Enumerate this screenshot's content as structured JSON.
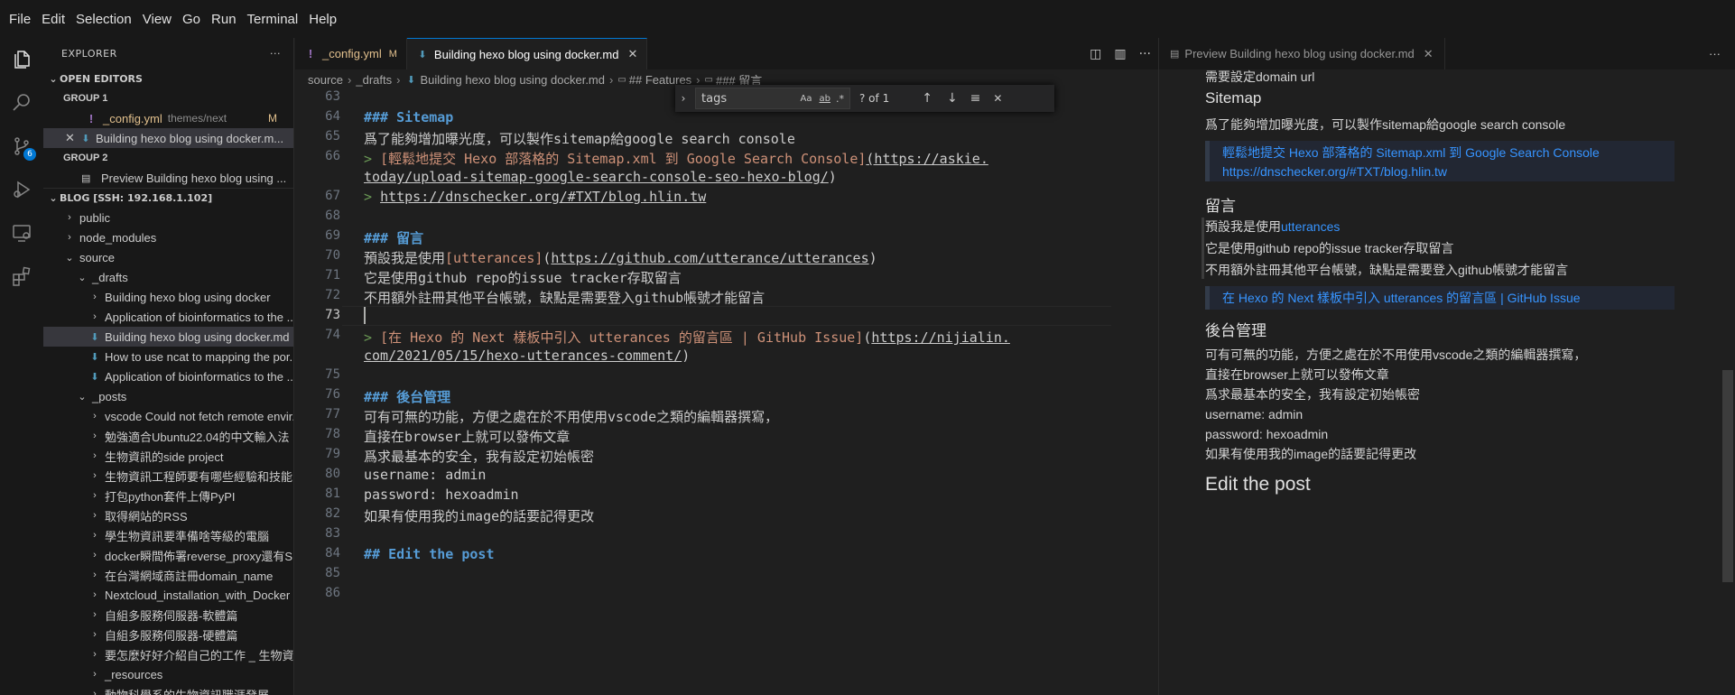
{
  "menu": [
    "File",
    "Edit",
    "Selection",
    "View",
    "Go",
    "Run",
    "Terminal",
    "Help"
  ],
  "explorer": {
    "title": "EXPLORER",
    "open_editors": "OPEN EDITORS",
    "group1": "GROUP 1",
    "g1_item1": "_config.yml",
    "g1_item1_path": "themes/next",
    "g1_item1_mod": "M",
    "g1_item2": "Building hexo blog using docker.m...",
    "group2": "GROUP 2",
    "g2_item1": "Preview Building hexo blog using ...",
    "workspace": "BLOG [SSH: 192.168.1.102]",
    "tree": [
      {
        "label": "public",
        "indent": 0,
        "type": "folder-closed"
      },
      {
        "label": "node_modules",
        "indent": 0,
        "type": "folder-closed"
      },
      {
        "label": "source",
        "indent": 0,
        "type": "folder-open"
      },
      {
        "label": "_drafts",
        "indent": 1,
        "type": "folder-open"
      },
      {
        "label": "Building hexo blog using docker",
        "indent": 2,
        "type": "folder-closed"
      },
      {
        "label": "Application of bioinformatics to the ...",
        "indent": 2,
        "type": "folder-closed"
      },
      {
        "label": "Building hexo blog using docker.md",
        "indent": 2,
        "type": "md",
        "selected": true
      },
      {
        "label": "How to use ncat to mapping the por...",
        "indent": 2,
        "type": "md"
      },
      {
        "label": "Application of bioinformatics to the ...",
        "indent": 2,
        "type": "md"
      },
      {
        "label": "_posts",
        "indent": 1,
        "type": "folder-open"
      },
      {
        "label": "vscode Could not fetch remote envir...",
        "indent": 2,
        "type": "folder-closed"
      },
      {
        "label": "勉強適合Ubuntu22.04的中文輸入法",
        "indent": 2,
        "type": "folder-closed"
      },
      {
        "label": "生物資訊的side project",
        "indent": 2,
        "type": "folder-closed"
      },
      {
        "label": "生物資訊工程師要有哪些經驗和技能",
        "indent": 2,
        "type": "folder-closed"
      },
      {
        "label": "打包python套件上傳PyPI",
        "indent": 2,
        "type": "folder-closed"
      },
      {
        "label": "取得網站的RSS",
        "indent": 2,
        "type": "folder-closed"
      },
      {
        "label": "學生物資訊要準備啥等級的電腦",
        "indent": 2,
        "type": "folder-closed"
      },
      {
        "label": "docker瞬間佈署reverse_proxy還有S...",
        "indent": 2,
        "type": "folder-closed"
      },
      {
        "label": "在台灣網域商註冊domain_name",
        "indent": 2,
        "type": "folder-closed"
      },
      {
        "label": "Nextcloud_installation_with_Docker",
        "indent": 2,
        "type": "folder-closed"
      },
      {
        "label": "自組多服務伺服器-軟體篇",
        "indent": 2,
        "type": "folder-closed"
      },
      {
        "label": "自組多服務伺服器-硬體篇",
        "indent": 2,
        "type": "folder-closed"
      },
      {
        "label": "要怎麼好好介紹自己的工作 _ 生物資訊",
        "indent": 2,
        "type": "folder-closed"
      },
      {
        "label": "_resources",
        "indent": 2,
        "type": "folder-closed"
      },
      {
        "label": "動物科學系的生物資訊職涯發展",
        "indent": 2,
        "type": "folder-closed"
      }
    ]
  },
  "tabs": {
    "tab1": "_config.yml",
    "tab1_mod": "M",
    "tab2": "Building hexo blog using docker.md",
    "preview": "Preview Building hexo blog using docker.md"
  },
  "breadcrumb": [
    "source",
    "_drafts",
    "Building hexo blog using docker.md",
    "## Features",
    "### 留言"
  ],
  "find": {
    "query": "tags",
    "result": "? of 1",
    "case": "Aa",
    "word": "ab",
    "regex": ".*"
  },
  "editor_lines": [
    "63",
    "64",
    "65",
    "66",
    "",
    "67",
    "68",
    "69",
    "70",
    "71",
    "72",
    "73",
    "74",
    "",
    "75",
    "76",
    "77",
    "78",
    "79",
    "80",
    "81",
    "82",
    "83",
    "84",
    "85",
    "86"
  ],
  "code": {
    "l64": "### Sitemap",
    "l65": "爲了能夠增加曝光度，可以製作sitemap給google search console",
    "l66_a": "> ",
    "l66_b": "[輕鬆地提交 Hexo 部落格的 Sitemap.xml 到 Google Search Console]",
    "l66_c": "(https://askie.",
    "l66_d": "today/upload-sitemap-google-search-console-seo-hexo-blog/",
    "l66_e": ")",
    "l67_a": "> ",
    "l67_b": "https://dnschecker.org/#TXT/blog.hlin.tw",
    "l69": "### 留言",
    "l70_a": "預設我是使用",
    "l70_b": "[utterances]",
    "l70_c": "(",
    "l70_d": "https://github.com/utterance/utterances",
    "l70_e": ")",
    "l71": "它是使用github repo的issue tracker存取留言",
    "l72": "不用額外註冊其他平台帳號，缺點是需要登入github帳號才能留言",
    "l74_a": "> ",
    "l74_b": "[在 Hexo 的 Next 樣板中引入 utterances 的留言區 | GitHub Issue]",
    "l74_c": "(",
    "l74_d": "https://nijialin.",
    "l74_e": "com/2021/05/15/hexo-utterances-comment/",
    "l74_f": ")",
    "l76": "### 後台管理",
    "l77": "可有可無的功能，方便之處在於不用使用vscode之類的編輯器撰寫，",
    "l78": "直接在browser上就可以發佈文章",
    "l79": "爲求最基本的安全，我有設定初始帳密",
    "l80": "username: admin",
    "l81": "password: hexoadmin",
    "l82": "如果有使用我的image的話要記得更改",
    "l84": "## Edit the post"
  },
  "preview": {
    "top_cut": "需要設定domain url",
    "h_sitemap": "Sitemap",
    "p_sitemap": "爲了能夠增加曝光度，可以製作sitemap給google search console",
    "q1_link": "輕鬆地提交 Hexo 部落格的 Sitemap.xml 到 Google Search Console",
    "q1_url": "https://dnschecker.org/#TXT/blog.hlin.tw",
    "h_comment": "留言",
    "c1_a": "預設我是使用",
    "c1_b": "utterances",
    "c2": "它是使用github repo的issue tracker存取留言",
    "c3": "不用額外註冊其他平台帳號，缺點是需要登入github帳號才能留言",
    "q2_link": "在 Hexo 的 Next 樣板中引入 utterances 的留言區 | GitHub Issue",
    "h_admin": "後台管理",
    "a1": "可有可無的功能，方便之處在於不用使用vscode之類的編輯器撰寫，",
    "a2": "直接在browser上就可以發佈文章",
    "a3": "爲求最基本的安全，我有設定初始帳密",
    "a4": "username: admin",
    "a5": "password: hexoadmin",
    "a6": "如果有使用我的image的話要記得更改",
    "h_edit": "Edit the post"
  },
  "scm_badge": "6"
}
